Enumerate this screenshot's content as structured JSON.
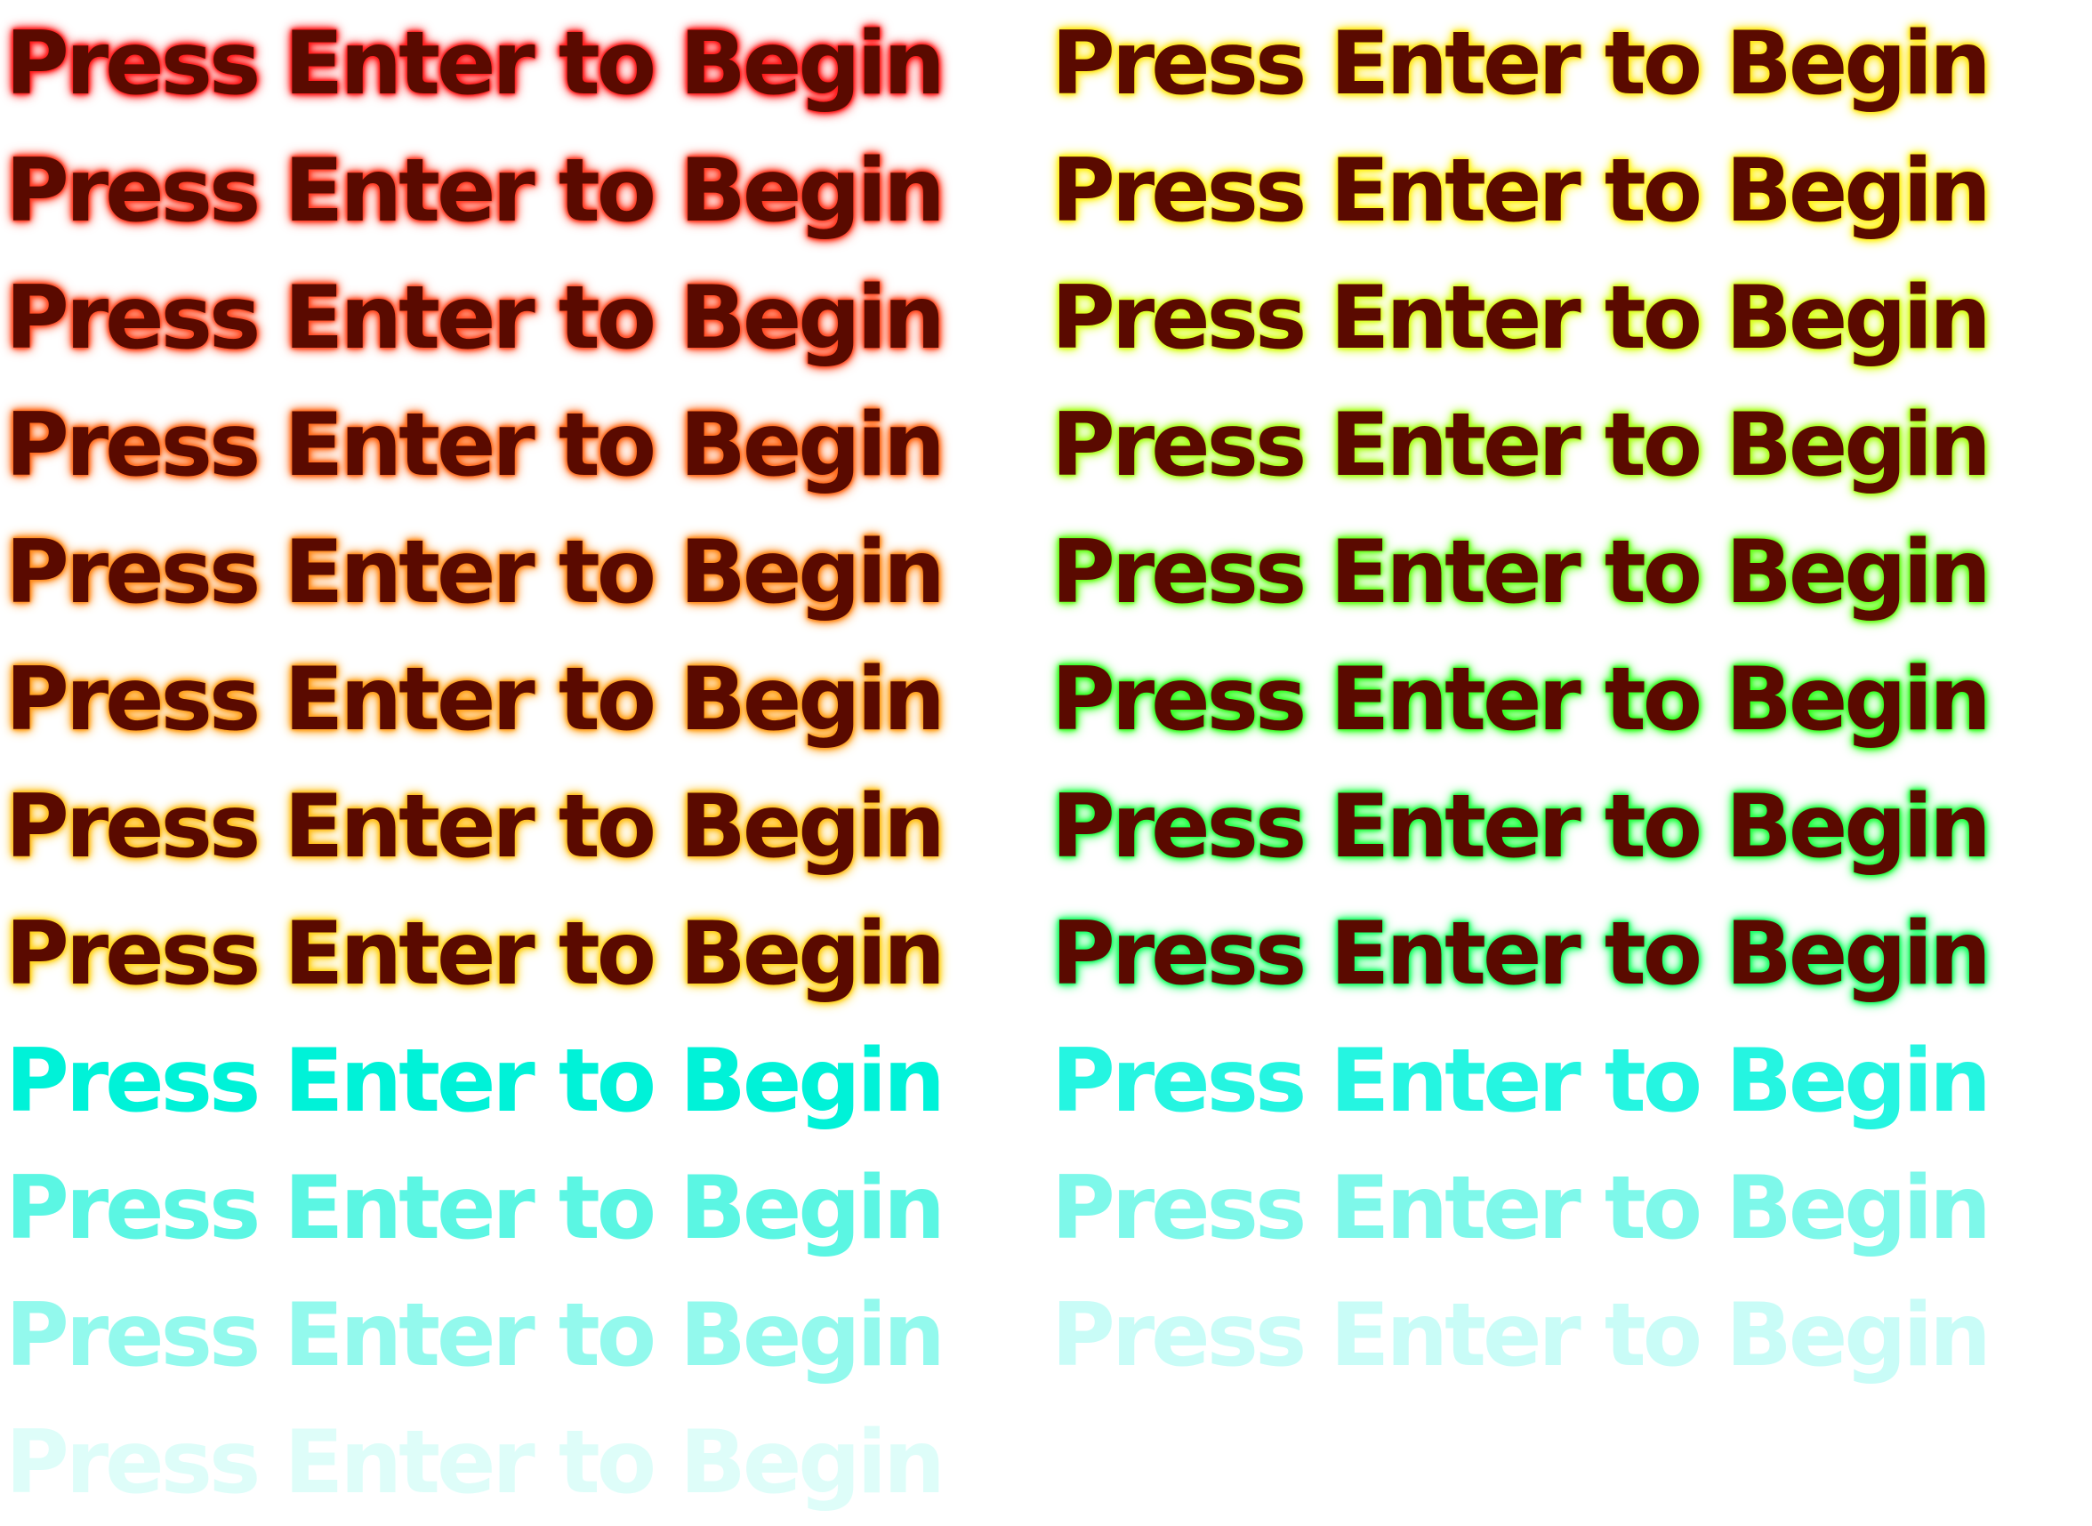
{
  "sheet": {
    "prompt_text": "Press Enter to Begin",
    "fill_color": "#5a0a00",
    "background": "#ffffff"
  },
  "frames": [
    {
      "label": "Press Enter to Begin",
      "style": "glow",
      "glow": "#ff1a1a",
      "fill": "#5a0a00"
    },
    {
      "label": "Press Enter to Begin",
      "style": "glow",
      "glow": "#ff3a22",
      "fill": "#5a0a00"
    },
    {
      "label": "Press Enter to Begin",
      "style": "glow",
      "glow": "#ff4a22",
      "fill": "#5a0a00"
    },
    {
      "label": "Press Enter to Begin",
      "style": "glow",
      "glow": "#ff6a1a",
      "fill": "#5a0a00"
    },
    {
      "label": "Press Enter to Begin",
      "style": "glow",
      "glow": "#ff8a1a",
      "fill": "#5a0a00"
    },
    {
      "label": "Press Enter to Begin",
      "style": "glow",
      "glow": "#ffa01a",
      "fill": "#5a0a00"
    },
    {
      "label": "Press Enter to Begin",
      "style": "glow",
      "glow": "#ffbf1a",
      "fill": "#5a0a00"
    },
    {
      "label": "Press Enter to Begin",
      "style": "glow",
      "glow": "#ffd21a",
      "fill": "#5a0a00"
    },
    {
      "label": "Press Enter to Begin",
      "style": "solid",
      "fill": "#00f2d8",
      "opacity": 1.0
    },
    {
      "label": "Press Enter to Begin",
      "style": "solid",
      "fill": "#3ff5df",
      "opacity": 0.85
    },
    {
      "label": "Press Enter to Begin",
      "style": "solid",
      "fill": "#66f7e6",
      "opacity": 0.7
    },
    {
      "label": "Press Enter to Begin",
      "style": "solid",
      "fill": "#b8fbf3",
      "opacity": 0.45
    },
    {
      "label": "Press Enter to Begin",
      "style": "glow",
      "glow": "#ffe81a",
      "fill": "#5a0a00"
    },
    {
      "label": "Press Enter to Begin",
      "style": "glow",
      "glow": "#fff21a",
      "fill": "#5a0a00"
    },
    {
      "label": "Press Enter to Begin",
      "style": "glow",
      "glow": "#d8ff1a",
      "fill": "#5a0a00"
    },
    {
      "label": "Press Enter to Begin",
      "style": "glow",
      "glow": "#a8ff1a",
      "fill": "#5a0a00"
    },
    {
      "label": "Press Enter to Begin",
      "style": "glow",
      "glow": "#66ff1a",
      "fill": "#5a0a00"
    },
    {
      "label": "Press Enter to Begin",
      "style": "glow",
      "glow": "#33ff22",
      "fill": "#5a0a00"
    },
    {
      "label": "Press Enter to Begin",
      "style": "glow",
      "glow": "#22ff44",
      "fill": "#5a0a00"
    },
    {
      "label": "Press Enter to Begin",
      "style": "glow",
      "glow": "#1aff66",
      "fill": "#5a0a00"
    },
    {
      "label": "Press Enter to Begin",
      "style": "solid",
      "fill": "#1af5e0",
      "opacity": 0.95
    },
    {
      "label": "Press Enter to Begin",
      "style": "solid",
      "fill": "#5ef7e6",
      "opacity": 0.8
    },
    {
      "label": "Press Enter to Begin",
      "style": "solid",
      "fill": "#a6fbf2",
      "opacity": 0.6
    }
  ]
}
